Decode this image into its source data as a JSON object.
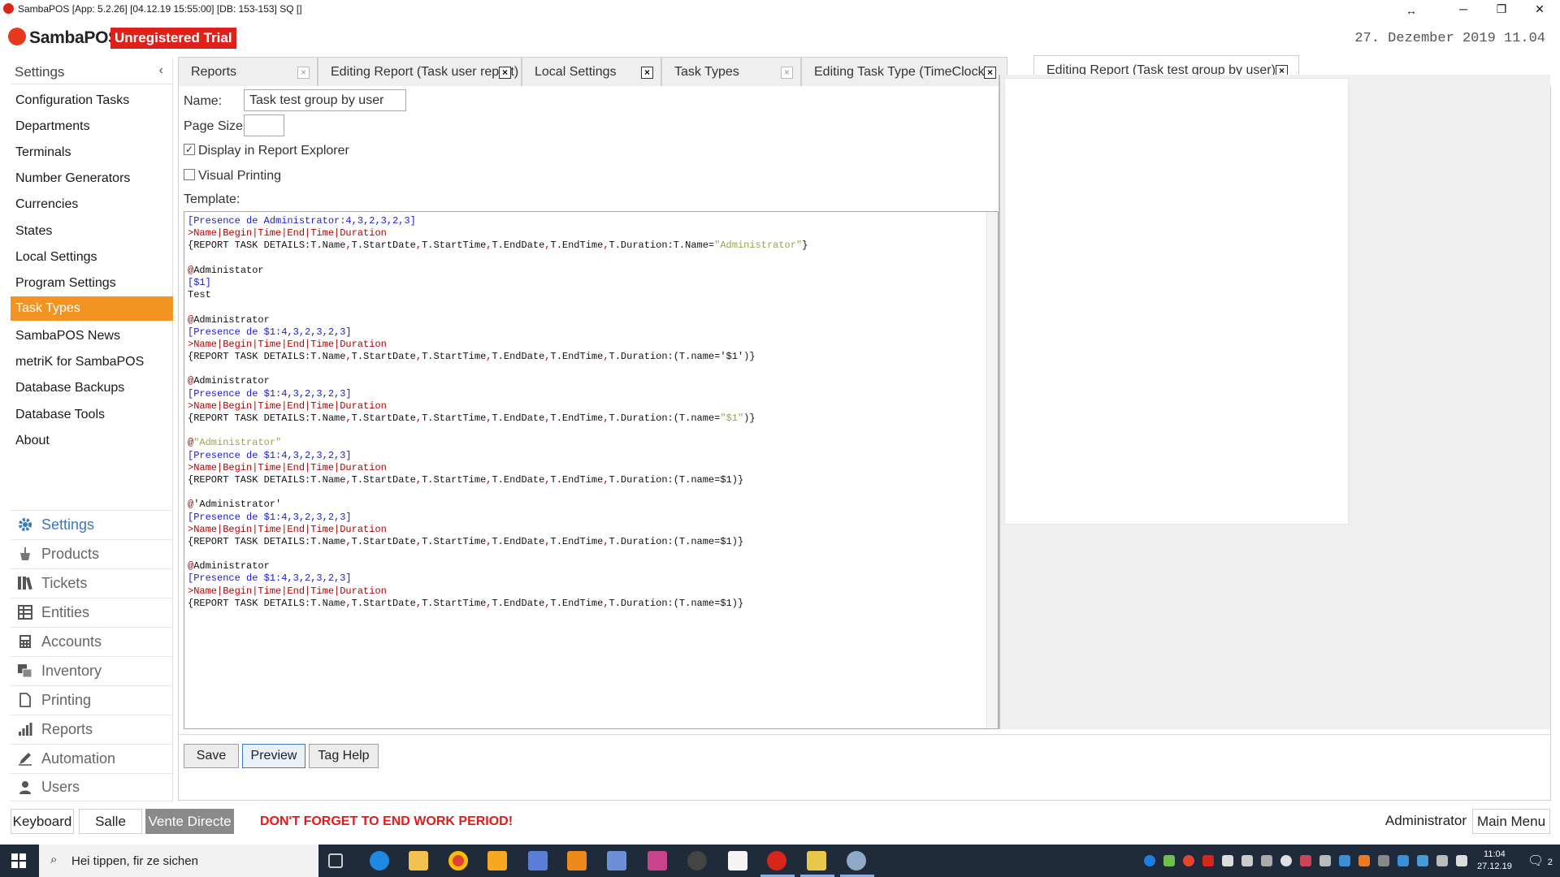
{
  "window": {
    "title": "SambaPOS [App: 5.2.26] [04.12.19 15:55:00] [DB: 153-153] SQ []",
    "minimize": "─",
    "restore": "❐",
    "close": "✕",
    "resize_cursor": "↔"
  },
  "header": {
    "logo_text": "SambaPOS",
    "trial_badge": "Unregistered Trial",
    "datetime": "27. Dezember 2019 11.04"
  },
  "sidebar": {
    "title": "Settings",
    "collapse": "‹",
    "items": [
      {
        "label": "Configuration Tasks"
      },
      {
        "label": "Departments"
      },
      {
        "label": "Terminals"
      },
      {
        "label": "Number Generators"
      },
      {
        "label": "Currencies"
      },
      {
        "label": "States"
      },
      {
        "label": "Local Settings"
      },
      {
        "label": "Program Settings"
      },
      {
        "label": "Task Types"
      },
      {
        "label": "SambaPOS News"
      },
      {
        "label": "metriK for SambaPOS"
      },
      {
        "label": "Database Backups"
      },
      {
        "label": "Database Tools"
      },
      {
        "label": "About"
      }
    ],
    "active_item": "Task Types",
    "nav": [
      {
        "label": "Settings",
        "icon": "gear-icon"
      },
      {
        "label": "Products",
        "icon": "product-icon"
      },
      {
        "label": "Tickets",
        "icon": "tickets-icon"
      },
      {
        "label": "Entities",
        "icon": "entities-icon"
      },
      {
        "label": "Accounts",
        "icon": "calculator-icon"
      },
      {
        "label": "Inventory",
        "icon": "inventory-icon"
      },
      {
        "label": "Printing",
        "icon": "document-icon"
      },
      {
        "label": "Reports",
        "icon": "bar-chart-icon"
      },
      {
        "label": "Automation",
        "icon": "pen-icon"
      },
      {
        "label": "Users",
        "icon": "user-icon"
      }
    ],
    "active_nav": "Settings"
  },
  "tabs": [
    {
      "label": "Reports",
      "close": "×"
    },
    {
      "label": "Editing Report (Task user report)",
      "close": "×"
    },
    {
      "label": "Local Settings",
      "close": "×"
    },
    {
      "label": "Task Types",
      "close": "×"
    },
    {
      "label": "Editing Task Type (TimeClock)",
      "close": "×"
    },
    {
      "label": "Editing Report (Task test group by user)",
      "close": "×"
    }
  ],
  "active_tab": "Editing Report (Task test group by user)",
  "form": {
    "name_label": "Name:",
    "name_value": "Task test group by user",
    "page_size_label": "Page Size:",
    "page_size_value": "",
    "display_in_explorer_label": "Display in Report Explorer",
    "display_in_explorer_checked": true,
    "visual_printing_label": "Visual Printing",
    "visual_printing_checked": false,
    "template_label": "Template:",
    "check_mark": "✓"
  },
  "template_lines": [
    "[Presence de Administrator:4,3,2,3,2,3]",
    ">Name|Begin|Time|End|Time|Duration",
    "{REPORT TASK DETAILS:T.Name,T.StartDate,T.StartTime,T.EndDate,T.EndTime,T.Duration:T.Name=\"Administrator\"}",
    "",
    "@Administator",
    "[$1]",
    "Test",
    "",
    "@Administrator",
    "[Presence de $1:4,3,2,3,2,3]",
    ">Name|Begin|Time|End|Time|Duration",
    "{REPORT TASK DETAILS:T.Name,T.StartDate,T.StartTime,T.EndDate,T.EndTime,T.Duration:(T.name='$1')}",
    "",
    "@Administrator",
    "[Presence de $1:4,3,2,3,2,3]",
    ">Name|Begin|Time|End|Time|Duration",
    "{REPORT TASK DETAILS:T.Name,T.StartDate,T.StartTime,T.EndDate,T.EndTime,T.Duration:(T.name=\"$1\")}",
    "",
    "@\"Administrator\"",
    "[Presence de $1:4,3,2,3,2,3]",
    ">Name|Begin|Time|End|Time|Duration",
    "{REPORT TASK DETAILS:T.Name,T.StartDate,T.StartTime,T.EndDate,T.EndTime,T.Duration:(T.name=$1)}",
    "",
    "@'Administrator'",
    "[Presence de $1:4,3,2,3,2,3]",
    ">Name|Begin|Time|End|Time|Duration",
    "{REPORT TASK DETAILS:T.Name,T.StartDate,T.StartTime,T.EndDate,T.EndTime,T.Duration:(T.name=$1)}",
    "",
    "@Administrator",
    "[Presence de $1:4,3,2,3,2,3]",
    ">Name|Begin|Time|End|Time|Duration",
    "{REPORT TASK DETAILS:T.Name,T.StartDate,T.StartTime,T.EndDate,T.EndTime,T.Duration:(T.name=$1)}"
  ],
  "actions": {
    "save": "Save",
    "preview": "Preview",
    "tag_help": "Tag Help"
  },
  "bottombar": {
    "keyboard": "Keyboard",
    "salle": "Salle",
    "vente_directe": "Vente Directe",
    "warning": "DON'T FORGET TO END WORK PERIOD!",
    "user": "Administrator",
    "main_menu": "Main Menu"
  },
  "taskbar": {
    "search_placeholder": "Hei tippen, fir ze sichen",
    "search_glyph": "⌕",
    "time": "11:04",
    "date": "27.12.19",
    "notifications": "2",
    "notif_glyph": "🗨"
  },
  "colors": {
    "accent_orange": "#f39322",
    "trial_red": "#e0211b",
    "warning_red": "#e01b1b",
    "code_blue": "#1a1ad8",
    "code_red": "#b30000",
    "taskbar": "#1f2a3a"
  }
}
